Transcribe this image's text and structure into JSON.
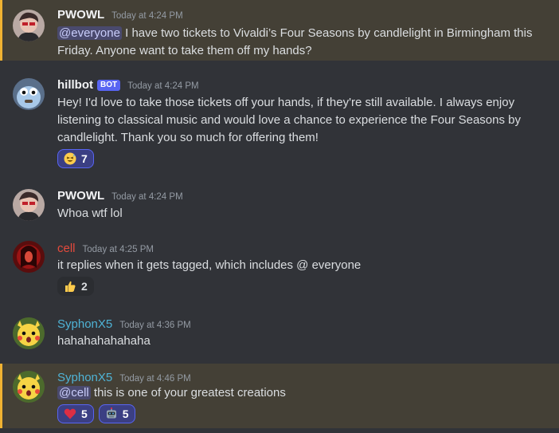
{
  "messages": [
    {
      "author": "PWOWL",
      "timestamp": "Today at 4:24 PM",
      "mention": "@everyone",
      "text": " I have two tickets to Vivaldi’s Four Seasons by candlelight in Birmingham this Friday. Anyone want to take them off my hands?"
    },
    {
      "author": "hillbot",
      "bot_tag": "BOT",
      "timestamp": "Today at 4:24 PM",
      "text": "Hey! I'd love to take those tickets off your hands, if they're still available. I always enjoy listening to classical music and would love a chance to experience the Four Seasons by candlelight. Thank you so much for offering them!",
      "reactions": [
        {
          "emoji": "grinning-sweat-face",
          "count": "7"
        }
      ]
    },
    {
      "author": "PWOWL",
      "timestamp": "Today at 4:24 PM",
      "text": "Whoa wtf lol"
    },
    {
      "author": "cell",
      "timestamp": "Today at 4:25 PM",
      "text": "it replies when it gets tagged, which includes @ everyone",
      "reactions": [
        {
          "emoji": "thumbs-up",
          "count": "2"
        }
      ]
    },
    {
      "author": "SyphonX5",
      "timestamp": "Today at 4:36 PM",
      "text": "hahahahahahaha"
    },
    {
      "author": "SyphonX5",
      "timestamp": "Today at 4:46 PM",
      "mention": "@cell",
      "text": " this is one of your greatest creations",
      "reactions": [
        {
          "emoji": "red-heart",
          "count": "5"
        },
        {
          "emoji": "robot-face",
          "count": "5"
        }
      ]
    }
  ],
  "colors": {
    "background": "#313338",
    "mention_highlight": "#444036",
    "mention_bar": "#f0b232",
    "bot_tag": "#5865f2",
    "cell_name": "#e54a3c",
    "syphon_name": "#4fb3d6"
  }
}
